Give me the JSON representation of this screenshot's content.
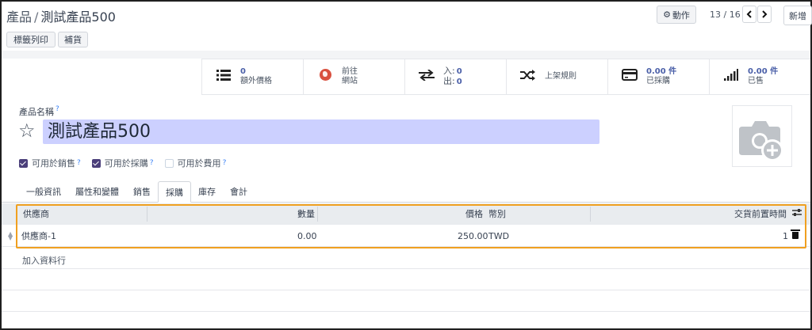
{
  "breadcrumb": {
    "parent": "產品",
    "separator": "/",
    "current": "測試產品500"
  },
  "toolbar": {
    "action_label": "動作",
    "pager": "13 / 16",
    "prev_icon": "chevron-left",
    "next_icon": "chevron-right",
    "new_label": "新增"
  },
  "buttons": {
    "label_print": "標籤列印",
    "restock": "補貨"
  },
  "stat_buttons": {
    "extra_prices": {
      "icon": "list-icon",
      "value": "0",
      "label": "額外價格"
    },
    "website": {
      "icon": "globe-icon",
      "line1": "前往",
      "line2": "網站"
    },
    "in_out": {
      "icon": "exchange-icon",
      "in_label": "入:",
      "in_value": "0",
      "out_label": "出:",
      "out_value": "0"
    },
    "routes": {
      "icon": "random-icon",
      "label": "上架規則"
    },
    "purchased": {
      "icon": "credit-card-icon",
      "value": "0.00 件",
      "label": "已採購"
    },
    "sold": {
      "icon": "signal-icon",
      "value": "0.00 件",
      "label": "已售"
    }
  },
  "form": {
    "name_label": "產品名稱",
    "help_mark": "?",
    "name_value": "測試產品500",
    "checkboxes": [
      {
        "label": "可用於銷售",
        "checked": true
      },
      {
        "label": "可用於採購",
        "checked": true
      },
      {
        "label": "可用於費用",
        "checked": false
      }
    ]
  },
  "tabs": [
    "一般資訊",
    "屬性和變體",
    "銷售",
    "採購",
    "庫存",
    "會計"
  ],
  "active_tab": "採購",
  "table": {
    "headers": {
      "vendor": "供應商",
      "qty": "數量",
      "price": "價格",
      "currency": "幣別",
      "lead_time": "交貨前置時間"
    },
    "rows": [
      {
        "vendor": "供應商-1",
        "qty": "0.00",
        "price": "250.00",
        "currency": "TWD",
        "lead_time": "1"
      }
    ],
    "add_line": "加入資料行"
  },
  "colors": {
    "accent": "#4b3f7a",
    "highlight": "#f0a020",
    "name_bg": "#ccd0ff",
    "link": "#4a5fa8"
  }
}
